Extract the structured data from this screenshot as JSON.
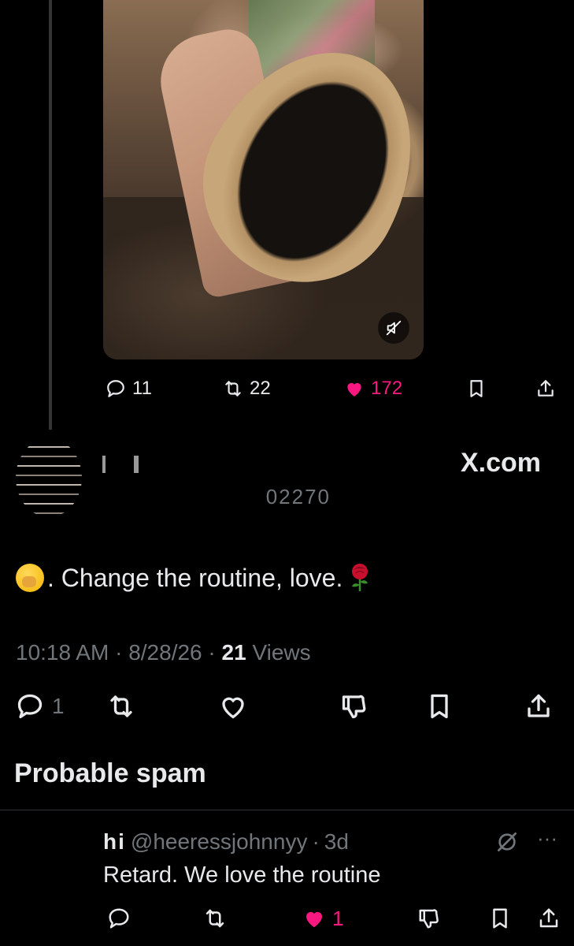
{
  "first_tweet": {
    "actions": {
      "replies": "11",
      "reposts": "22",
      "likes": "172"
    }
  },
  "reply_tweet": {
    "author_name_visible": "",
    "handle_visible": "02270",
    "source_label": "X.com",
    "text": ". Change the routine, love.",
    "emoji_start": "face-with-hand-over-mouth-emoji",
    "emoji_end": "rose-emoji",
    "time": "10:18 AM",
    "date": "8/28/26",
    "views_count": "21",
    "views_label": "Views",
    "actions": {
      "replies": "1"
    },
    "label": "Probable spam"
  },
  "nested_reply": {
    "name": "hi",
    "handle": "@heeressjohnnyy",
    "age": "3d",
    "text": "Retard. We love the routine",
    "actions": {
      "likes": "1"
    }
  },
  "colors": {
    "background": "#000000",
    "text": "#e7e9ea",
    "muted": "#71767b",
    "like": "#f91880",
    "divider": "#2f3336"
  }
}
